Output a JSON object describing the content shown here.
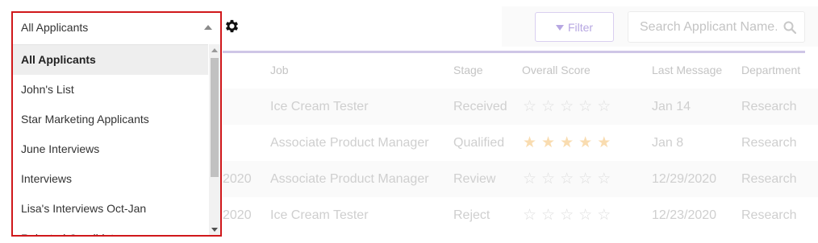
{
  "dropdown": {
    "selected": "All Applicants",
    "items": [
      "All Applicants",
      "John's List",
      "Star Marketing Applicants",
      "June Interviews",
      "Interviews",
      "Lisa's Interviews Oct-Jan",
      "Rejected Candidates"
    ]
  },
  "toolbar": {
    "filter_label": "Filter",
    "search_placeholder": "Search Applicant Name..",
    "settings_icon": "gear-icon"
  },
  "table": {
    "headers": {
      "job": "Job",
      "stage": "Stage",
      "score": "Overall Score",
      "last_message": "Last Message",
      "department": "Department"
    },
    "rows": [
      {
        "date": "",
        "job": "Ice Cream Tester",
        "stage": "Received",
        "stars": 0,
        "last_message": "Jan 14",
        "department": "Research"
      },
      {
        "date": "",
        "job": "Associate Product Manager",
        "stage": "Qualified",
        "stars": 5,
        "last_message": "Jan 8",
        "department": "Research"
      },
      {
        "date": "2020",
        "job": "Associate Product Manager",
        "stage": "Review",
        "stars": 0,
        "last_message": "12/29/2020",
        "department": "Research"
      },
      {
        "date": "2020",
        "job": "Ice Cream Tester",
        "stage": "Reject",
        "stars": 0,
        "last_message": "12/23/2020",
        "department": "Research"
      }
    ]
  },
  "colors": {
    "highlight_border": "#d0181b",
    "accent": "#b7a7e2",
    "star_on": "#f9dcb0"
  }
}
